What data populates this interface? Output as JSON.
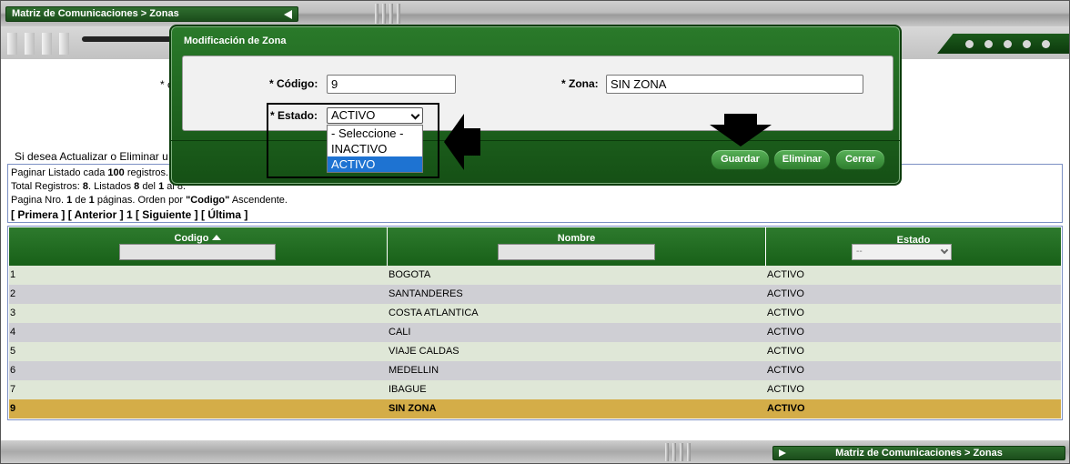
{
  "header": {
    "breadcrumb": "Matriz de Comunicaciones > Zonas"
  },
  "footer": {
    "breadcrumb": "Matriz de Comunicaciones > Zonas"
  },
  "page": {
    "asterisk_label": "* c",
    "instructions": "Si desea Actualizar o Eliminar u"
  },
  "info": {
    "line1_prefix": "Paginar Listado cada ",
    "line1_count": "100",
    "line1_suffix": " registros.",
    "line2_a": "Total Registros: ",
    "line2_total": "8",
    "line2_b": ". Listados ",
    "line2_from": "8",
    "line2_c": " del ",
    "line2_page": "1",
    "line2_d": " al 8.",
    "line3_a": "Pagina Nro. ",
    "line3_page": "1",
    "line3_b": " de ",
    "line3_pages": "1",
    "line3_c": " páginas. Orden por ",
    "line3_order": "\"Codigo\"",
    "line3_d": " Ascendente.",
    "nav_first": "[ Primera ]",
    "nav_prev": "[ Anterior ]",
    "nav_current": "1",
    "nav_next": "[ Siguiente ]",
    "nav_last": "[ Última ]"
  },
  "table": {
    "col_codigo": "Codigo",
    "col_nombre": "Nombre",
    "col_estado": "Estado",
    "estado_filter": "--",
    "rows": [
      {
        "codigo": "1",
        "nombre": "BOGOTA",
        "estado": "ACTIVO"
      },
      {
        "codigo": "2",
        "nombre": "SANTANDERES",
        "estado": "ACTIVO"
      },
      {
        "codigo": "3",
        "nombre": "COSTA ATLANTICA",
        "estado": "ACTIVO"
      },
      {
        "codigo": "4",
        "nombre": "CALI",
        "estado": "ACTIVO"
      },
      {
        "codigo": "5",
        "nombre": "VIAJE CALDAS",
        "estado": "ACTIVO"
      },
      {
        "codigo": "6",
        "nombre": "MEDELLIN",
        "estado": "ACTIVO"
      },
      {
        "codigo": "7",
        "nombre": "IBAGUE",
        "estado": "ACTIVO"
      },
      {
        "codigo": "9",
        "nombre": "SIN ZONA",
        "estado": "ACTIVO"
      }
    ]
  },
  "modal": {
    "title": "Modificación de Zona",
    "codigo_label": "* Código:",
    "codigo_value": "9",
    "zona_label": "* Zona:",
    "zona_value": "SIN ZONA",
    "estado_label": "* Estado:",
    "estado_value": "ACTIVO",
    "estado_options": [
      "- Seleccione -",
      "INACTIVO",
      "ACTIVO"
    ],
    "btn_guardar": "Guardar",
    "btn_eliminar": "Eliminar",
    "btn_cerrar": "Cerrar"
  },
  "colors": {
    "accent_green": "#1b4d1b",
    "selected_row": "#d4ad48",
    "highlight_blue": "#1e73d2"
  }
}
